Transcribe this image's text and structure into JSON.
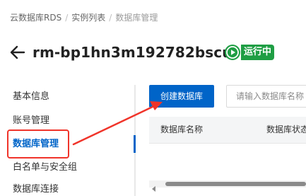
{
  "breadcrumb": {
    "items": [
      "云数据库RDS",
      "实例列表",
      "数据库管理"
    ],
    "separator": "/"
  },
  "header": {
    "instance_id": "rm-bp1hn3m192782bscu",
    "status": "运行中",
    "status_color": "#1f9e44"
  },
  "sidebar": {
    "items": [
      {
        "label": "基本信息"
      },
      {
        "label": "账号管理"
      },
      {
        "label": "数据库管理",
        "active": true
      },
      {
        "label": "白名单与安全组"
      },
      {
        "label": "数据库连接"
      }
    ]
  },
  "toolbar": {
    "create_label": "创建数据库",
    "search_placeholder": "请输入数据库名称"
  },
  "table": {
    "columns": [
      "数据库名称",
      "数据库状态"
    ]
  },
  "colors": {
    "primary": "#0064c8",
    "annotation": "#f0342a"
  }
}
